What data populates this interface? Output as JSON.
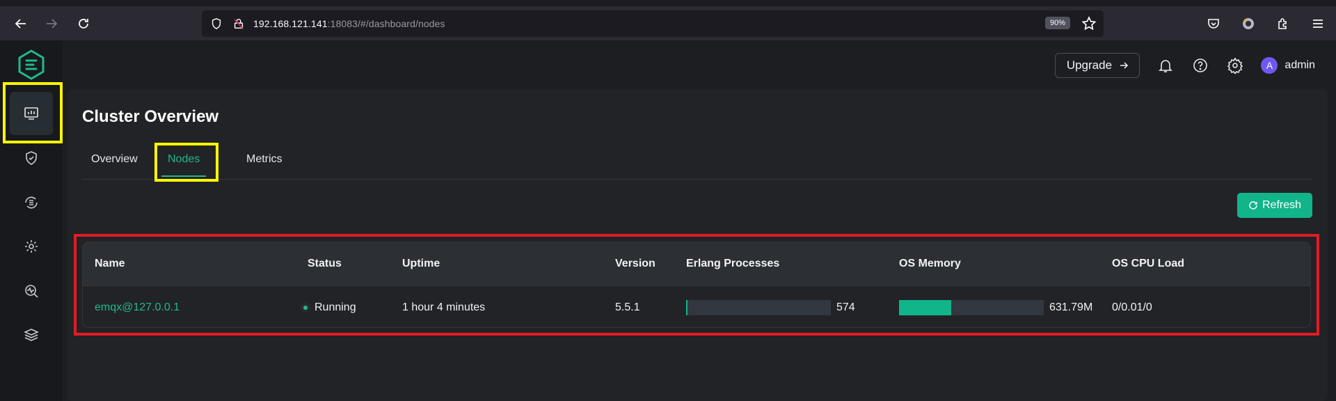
{
  "browser": {
    "url_host": "192.168.121.141",
    "url_rest": ":18083/#/dashboard/nodes",
    "zoom": "90%"
  },
  "header": {
    "upgrade_label": "Upgrade",
    "user_initial": "A",
    "user_name": "admin"
  },
  "sidebar": {
    "items": [
      {
        "icon": "dashboard-icon",
        "active": true
      },
      {
        "icon": "shield-check-icon",
        "active": false
      },
      {
        "icon": "integration-icon",
        "active": false
      },
      {
        "icon": "gear-settings-icon",
        "active": false
      },
      {
        "icon": "diagnose-icon",
        "active": false
      },
      {
        "icon": "layers-icon",
        "active": false
      }
    ]
  },
  "page": {
    "title": "Cluster Overview",
    "tabs": [
      {
        "label": "Overview"
      },
      {
        "label": "Nodes",
        "active": true
      },
      {
        "label": "Metrics"
      }
    ],
    "refresh_label": "Refresh"
  },
  "table": {
    "columns": [
      "Name",
      "Status",
      "Uptime",
      "Version",
      "Erlang Processes",
      "OS Memory",
      "OS CPU Load"
    ],
    "rows": [
      {
        "name": "emqx@127.0.0.1",
        "status": "Running",
        "uptime": "1 hour 4 minutes",
        "version": "5.5.1",
        "erlang_processes": "574",
        "erlang_processes_fill": 0.01,
        "os_memory": "631.79M",
        "os_memory_fill": 0.36,
        "os_cpu_load": "0/0.01/0"
      }
    ]
  },
  "colors": {
    "accent": "#21b98b",
    "highlight_yellow": "#fff700",
    "highlight_red": "#e31b23"
  }
}
